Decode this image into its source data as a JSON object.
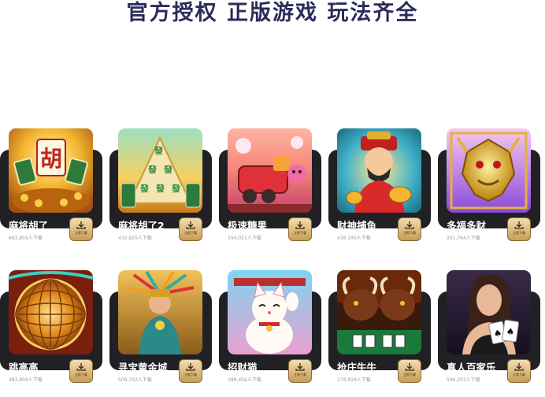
{
  "headline": "官方授权 正版游戏 玩法齐全",
  "download_label": "立即下载",
  "icons": {
    "download": "download-icon"
  },
  "colors": {
    "card_bg": "#212125",
    "headline": "#2b2c5a",
    "button": "#d8b26e"
  },
  "games": [
    {
      "id": "mahjong-ways",
      "title": "麻将胡了",
      "plays": "683,859人下载"
    },
    {
      "id": "mahjong-ways-2",
      "title": "麻将胡了2",
      "plays": "432,825人下载"
    },
    {
      "id": "candy-express",
      "title": "极速糖果",
      "plays": "594,021人下载"
    },
    {
      "id": "fortune-fishing",
      "title": "财神捕鱼",
      "plays": "438,190人下载"
    },
    {
      "id": "fortune-dragon",
      "title": "多福多财",
      "plays": "251,764人下载"
    },
    {
      "id": "high-jump",
      "title": "跳高高",
      "plays": "483,859人下载"
    },
    {
      "id": "gold-treasure",
      "title": "寻宝黄金城",
      "plays": "509,332人下载"
    },
    {
      "id": "lucky-cat",
      "title": "招财猫",
      "plays": "389,456人下载"
    },
    {
      "id": "bull-fight",
      "title": "抢庄牛牛",
      "plays": "274,918人下载"
    },
    {
      "id": "baccarat",
      "title": "真人百家乐",
      "plays": "596,203人下载"
    }
  ]
}
